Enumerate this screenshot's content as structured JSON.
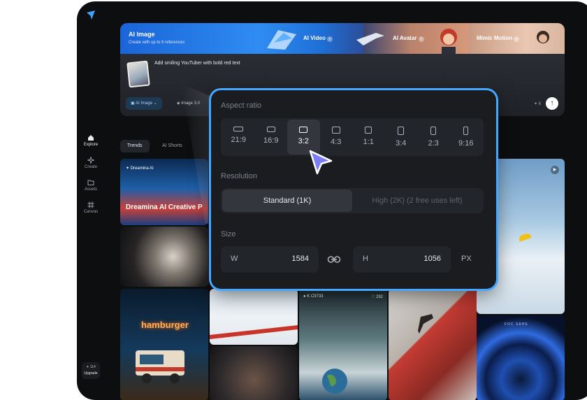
{
  "sidebar": {
    "items": [
      {
        "label": "Explore",
        "icon": "home-icon"
      },
      {
        "label": "Create",
        "icon": "sparkle-icon"
      },
      {
        "label": "Assets",
        "icon": "folder-icon"
      },
      {
        "label": "Canvas",
        "icon": "canvas-icon"
      }
    ],
    "upgrade_credits": "✦ 114",
    "upgrade_label": "Upgrade"
  },
  "hero": {
    "ai_image_title": "AI Image",
    "ai_image_sub": "Create with up to 6 references",
    "ai_video": "AI Video",
    "ai_avatar": "AI Avatar",
    "mimic_motion": "Mimic Motion",
    "prompt": "Add smiling YouTuber with bold red text",
    "chip_ai_image": "AI Image",
    "chip_model": "Image 3.0",
    "cost": "✦ 6"
  },
  "tabs": [
    {
      "label": "Trends"
    },
    {
      "label": "AI Shorts"
    }
  ],
  "gallery": {
    "brand": "Dreamina AI",
    "title": "Dreamina AI Creative P",
    "neon": "hamburger",
    "user": "K C9733",
    "likes": "292",
    "tile_text": "FOC SAHS"
  },
  "popup": {
    "aspect_label": "Aspect ratio",
    "ratios": [
      "21:9",
      "16:9",
      "3:2",
      "4:3",
      "1:1",
      "3:4",
      "2:3",
      "9:16"
    ],
    "selected_ratio": "3:2",
    "resolution_label": "Resolution",
    "res_standard": "Standard (1K)",
    "res_high": "High (2K)  (2 free uses left)",
    "size_label": "Size",
    "w_label": "W",
    "w_value": "1584",
    "h_label": "H",
    "h_value": "1056",
    "unit": "PX"
  },
  "colors": {
    "accent": "#45a7ff",
    "background": "#0d0e10",
    "panel": "#1a1c20"
  }
}
